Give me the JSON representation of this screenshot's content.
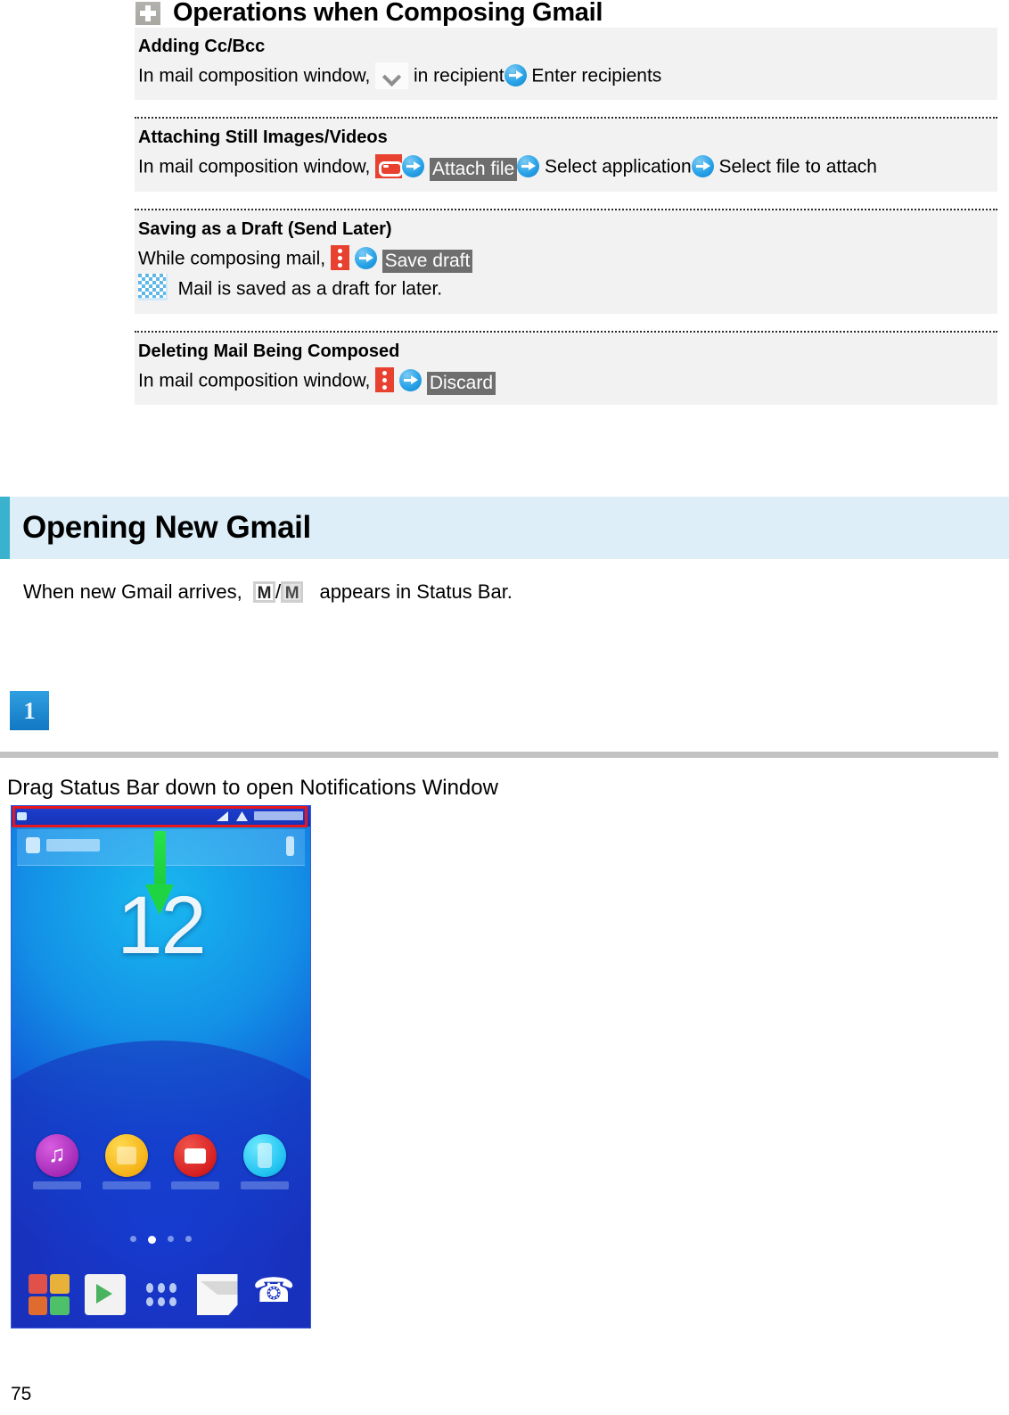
{
  "operations": {
    "title": "Operations when Composing Gmail",
    "title_icon": "plus-icon",
    "items": [
      {
        "heading": "Adding Cc/Bcc",
        "prefix": "In mail composition window,",
        "icon1": "chevron-down-icon",
        "mid1": "in recipient",
        "icon2": "blue-arrow-icon",
        "tail": "Enter recipients"
      },
      {
        "heading": "Attaching Still Images/Videos",
        "prefix": "In mail composition window,",
        "icon1": "attach-clip-icon",
        "icon2": "blue-arrow-icon",
        "highlight1": "Attach file",
        "icon3": "blue-arrow-icon",
        "mid1": "Select application",
        "icon4": "blue-arrow-icon",
        "tail": "Select file to attach"
      },
      {
        "heading": "Saving as a Draft (Send Later)",
        "prefix": "While composing mail,",
        "icon1": "overflow-menu-icon",
        "icon2": "blue-arrow-icon",
        "highlight1": "Save draft",
        "note_icon": "draft-note-icon",
        "note": "Mail is saved as a draft for later."
      },
      {
        "heading": "Deleting Mail Being Composed",
        "prefix": "In mail composition window,",
        "icon1": "overflow-menu-icon",
        "icon2": "blue-arrow-icon",
        "highlight1": "Discard"
      }
    ]
  },
  "section": {
    "title": "Opening New Gmail",
    "accent_color": "#3bb2cd",
    "background_color": "#ddeef8",
    "intro_prefix": "When new Gmail arrives,",
    "intro_icon1": "gmail-new-icon",
    "intro_separator": "/",
    "intro_icon2": "gmail-new-alt-icon",
    "intro_suffix": "appears in Status Bar."
  },
  "step": {
    "number": "1",
    "badge_color": "#1278c4",
    "text": "Drag Status Bar down to open Notifications Window"
  },
  "phone": {
    "clock": "12",
    "highlight_color": "#e8161d",
    "arrow_color": "#1fd442",
    "page_dots": 4,
    "active_dot": 2
  },
  "footer": {
    "page_number": "75"
  }
}
